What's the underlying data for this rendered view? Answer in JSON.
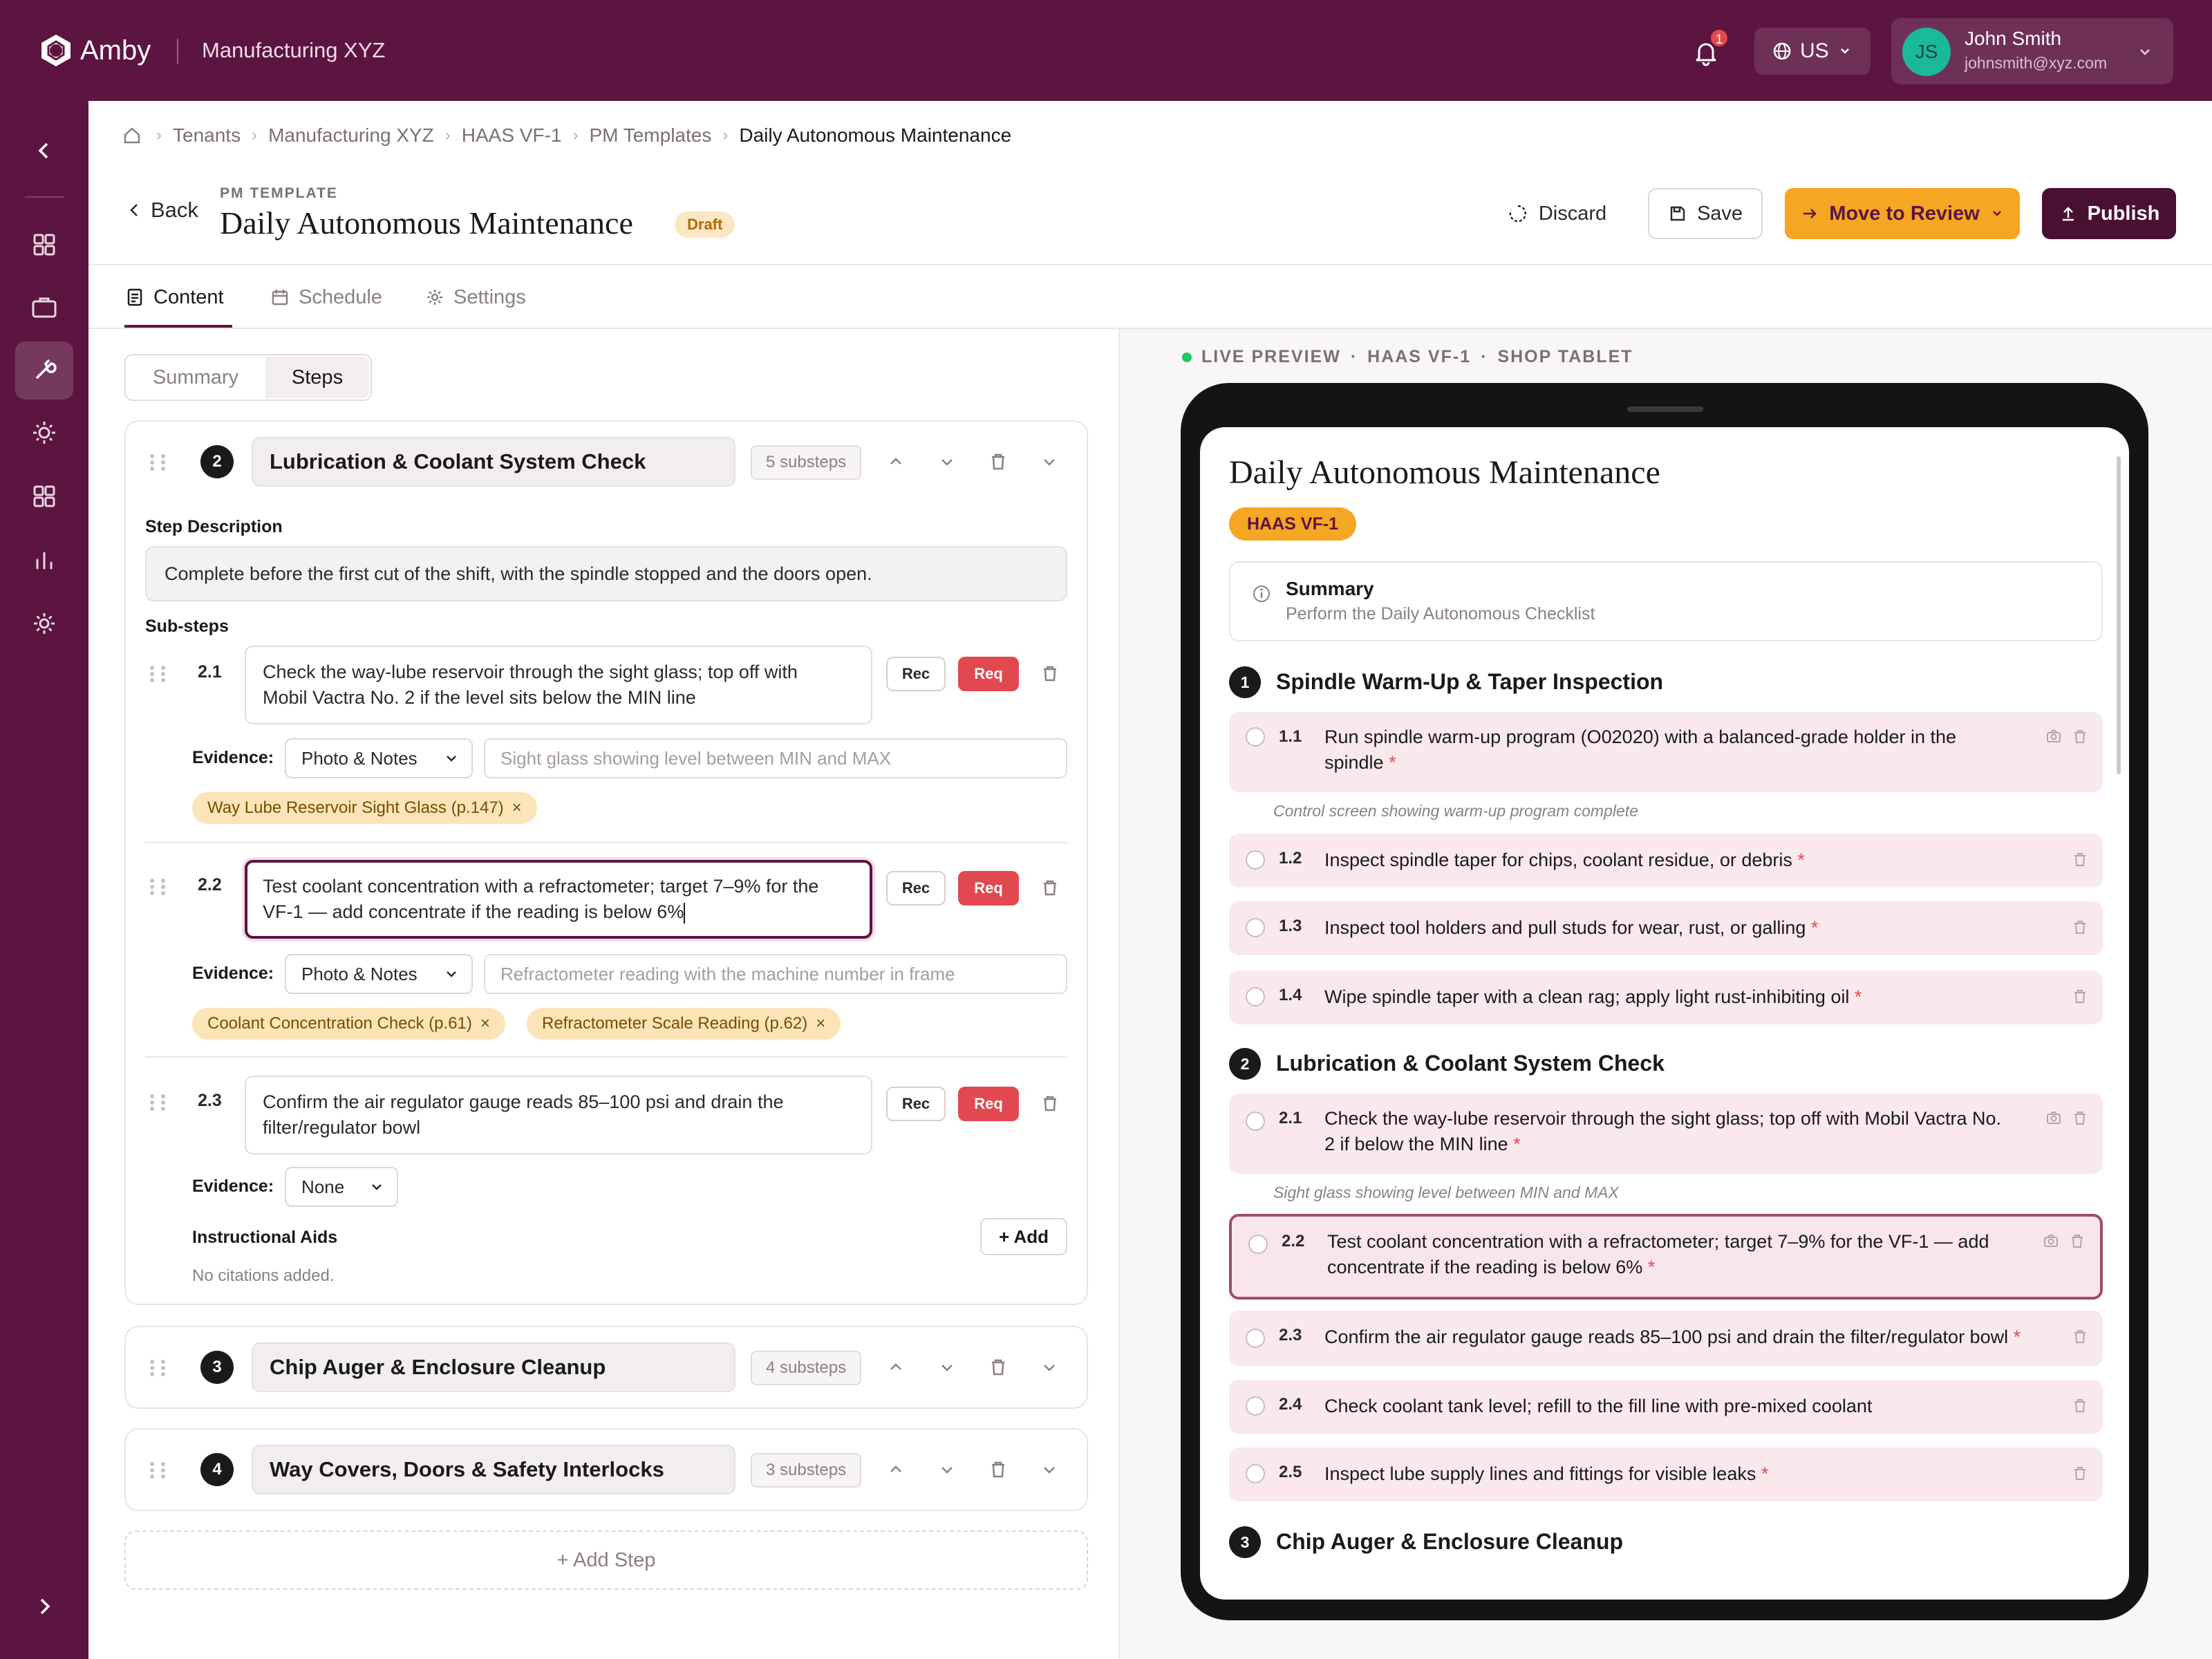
{
  "app": {
    "brand": "Amby",
    "tenant": "Manufacturing XYZ"
  },
  "header": {
    "notification_count": "1",
    "region": "US",
    "user": {
      "initials": "JS",
      "name": "John Smith",
      "email": "johnsmith@xyz.com"
    }
  },
  "breadcrumb": [
    "Tenants",
    "Manufacturing XYZ",
    "HAAS VF-1",
    "PM Templates",
    "Daily Autonomous Maintenance"
  ],
  "page": {
    "back_label": "Back",
    "eyebrow": "PM TEMPLATE",
    "title": "Daily Autonomous Maintenance",
    "status": "Draft",
    "discard_label": "Discard",
    "save_label": "Save",
    "review_label": "Move to Review",
    "publish_label": "Publish"
  },
  "tabs": [
    {
      "label": "Content"
    },
    {
      "label": "Schedule"
    },
    {
      "label": "Settings"
    }
  ],
  "segment": {
    "summary": "Summary",
    "steps": "Steps"
  },
  "editor": {
    "step2": {
      "number": "2",
      "title": "Lubrication & Coolant System Check",
      "substeps_count": "5 substeps",
      "description_label": "Step Description",
      "description": "Complete before the first cut of the shift, with the spindle stopped and the doors open.",
      "substeps_label": "Sub-steps",
      "substeps": [
        {
          "num": "2.1",
          "line1": "Check the way-lube reservoir through the sight glass; top off with",
          "line2": "Mobil Vactra No. 2 if the level sits below the MIN line",
          "evidence": "Photo & Notes",
          "evidence_placeholder": "Sight glass showing level between MIN and MAX",
          "chips": [
            "Way Lube Reservoir Sight Glass (p.147)"
          ]
        },
        {
          "num": "2.2",
          "line1": "Test coolant concentration with a refractometer; target 7–9% for the",
          "line2": "VF-1 — add concentrate if the reading is below 6%",
          "evidence": "Photo & Notes",
          "evidence_placeholder": "Refractometer reading with the machine number in frame",
          "chips": [
            "Coolant Concentration Check (p.61)",
            "Refractometer Scale Reading (p.62)"
          ]
        },
        {
          "num": "2.3",
          "line1": "Confirm the air regulator gauge reads 85–100 psi and drain the",
          "line2": "filter/regulator bowl",
          "evidence": "None"
        }
      ],
      "rec_label": "Rec",
      "req_label": "Req",
      "evidence_label": "Evidence:",
      "aids_label": "Instructional Aids",
      "add_label": "Add",
      "no_citations": "No citations added."
    },
    "step3": {
      "number": "3",
      "title": "Chip Auger & Enclosure Cleanup",
      "substeps_count": "4 substeps"
    },
    "step4": {
      "number": "4",
      "title": "Way Covers, Doors & Safety Interlocks",
      "substeps_count": "3 substeps"
    },
    "add_step_label": "Add Step"
  },
  "preview": {
    "live_label": "LIVE PREVIEW",
    "machine_label": "HAAS VF-1",
    "device_label": "SHOP TABLET",
    "title": "Daily Autonomous Maintenance",
    "machine_badge": "HAAS VF-1",
    "summary_title": "Summary",
    "summary_text": "Perform the Daily Autonomous Checklist",
    "sections": [
      {
        "number": "1",
        "title": "Spindle Warm-Up & Taper Inspection",
        "items": [
          {
            "num": "1.1",
            "line1": "Run spindle warm-up program (O02020) with a balanced-grade holder in the",
            "line2": "spindle",
            "evidence": "Control screen showing warm-up program complete"
          },
          {
            "num": "1.2",
            "text": "Inspect spindle taper for chips, coolant residue, or debris"
          },
          {
            "num": "1.3",
            "text": "Inspect tool holders and pull studs for wear, rust, or galling"
          },
          {
            "num": "1.4",
            "text": "Wipe spindle taper with a clean rag; apply light rust-inhibiting oil"
          }
        ]
      },
      {
        "number": "2",
        "title": "Lubrication & Coolant System Check",
        "items": [
          {
            "num": "2.1",
            "line1": "Check the way-lube reservoir through the sight glass; top off with Mobil Vactra No.",
            "line2": "2 if below the MIN line",
            "evidence": "Sight glass showing level between MIN and MAX"
          },
          {
            "num": "2.2",
            "line1": "Test coolant concentration with a refractometer; target 7–9% for the VF-1 — add",
            "line2": "concentrate if the reading is below 6%"
          },
          {
            "num": "2.3",
            "text": "Confirm the air regulator gauge reads 85–100 psi and drain the filter/regulator bowl"
          },
          {
            "num": "2.4",
            "text": "Check coolant tank level; refill to the fill line with pre-mixed coolant"
          },
          {
            "num": "2.5",
            "text": "Inspect lube supply lines and fittings for visible leaks"
          }
        ]
      },
      {
        "number": "3",
        "title": "Chip Auger & Enclosure Cleanup"
      }
    ]
  },
  "colors": {
    "brand": "#5c1440",
    "accent": "#f5a623",
    "required": "#e2484f",
    "live": "#22c55e"
  }
}
